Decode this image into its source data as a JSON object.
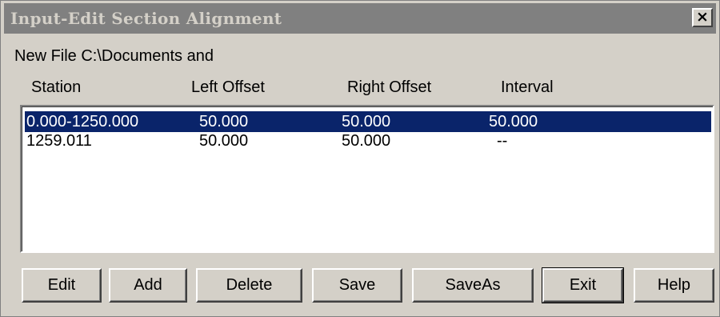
{
  "window": {
    "title": "Input-Edit Section Alignment",
    "close_label": "×"
  },
  "file_label": "New File C:\\Documents and",
  "columns": [
    "Station",
    "Left Offset",
    "Right Offset",
    "Interval"
  ],
  "rows": [
    {
      "station": "0.000-1250.000",
      "left_offset": "50.000",
      "right_offset": "50.000",
      "interval": "50.000",
      "selected": true
    },
    {
      "station": "1259.011",
      "left_offset": "50.000",
      "right_offset": "50.000",
      "interval": "--",
      "selected": false
    }
  ],
  "buttons": {
    "edit": "Edit",
    "add": "Add",
    "delete": "Delete",
    "save": "Save",
    "save_as": "SaveAs",
    "exit": "Exit",
    "help": "Help"
  },
  "colors": {
    "title_bar": "#808080",
    "selection": "#0a246a",
    "window_bg": "#d4d0c8"
  }
}
